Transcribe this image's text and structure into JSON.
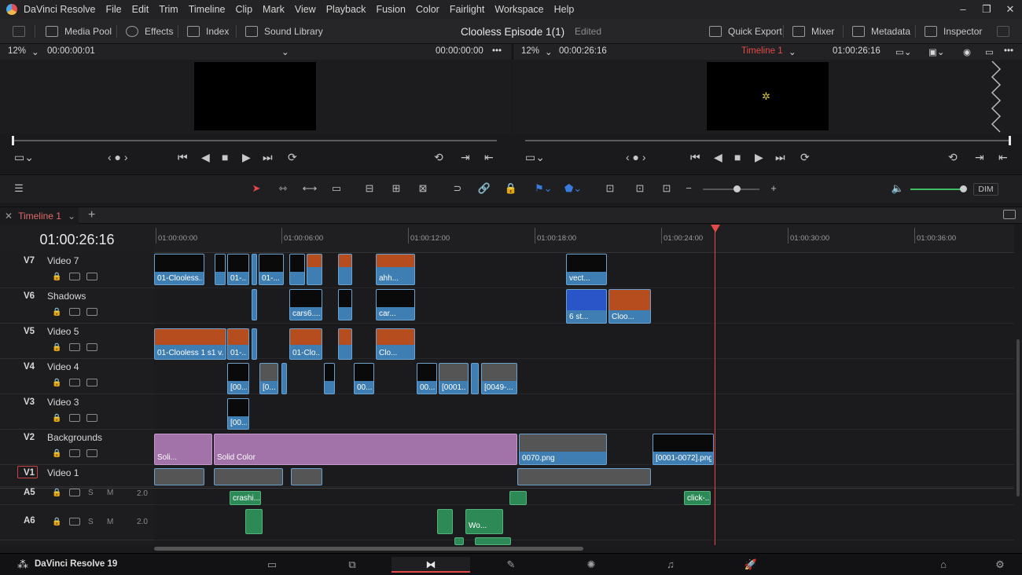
{
  "app": {
    "name": "DaVinci Resolve",
    "footer_name": "DaVinci Resolve 19"
  },
  "menu": [
    "File",
    "Edit",
    "Trim",
    "Timeline",
    "Clip",
    "Mark",
    "View",
    "Playback",
    "Fusion",
    "Color",
    "Fairlight",
    "Workspace",
    "Help"
  ],
  "toolbar": {
    "media_pool": "Media Pool",
    "effects": "Effects",
    "index": "Index",
    "sound_library": "Sound Library",
    "project_title": "Clooless Episode 1(1)",
    "project_status": "Edited",
    "quick_export": "Quick Export",
    "mixer": "Mixer",
    "metadata": "Metadata",
    "inspector": "Inspector"
  },
  "source_viewer": {
    "zoom": "12%",
    "timecode_left": "00:00:00:01",
    "timecode_right": "00:00:00:00"
  },
  "timeline_viewer": {
    "zoom": "12%",
    "timecode_left": "00:00:26:16",
    "timeline_name": "Timeline 1",
    "timecode_right": "01:00:26:16"
  },
  "audio": {
    "dim_label": "DIM"
  },
  "timeline": {
    "tab": "Timeline 1",
    "timecode": "01:00:26:16",
    "ruler": [
      "01:00:00:00",
      "01:00:06:00",
      "01:00:12:00",
      "01:00:18:00",
      "01:00:24:00",
      "01:00:30:00",
      "01:00:36:00"
    ],
    "tracks": [
      {
        "id": "V7",
        "name": "Video 7"
      },
      {
        "id": "V6",
        "name": "Shadows"
      },
      {
        "id": "V5",
        "name": "Video 5"
      },
      {
        "id": "V4",
        "name": "Video 4"
      },
      {
        "id": "V3",
        "name": "Video 3"
      },
      {
        "id": "V2",
        "name": "Backgrounds"
      },
      {
        "id": "V1",
        "name": "Video 1"
      },
      {
        "id": "A5",
        "name": "",
        "level": "2.0"
      },
      {
        "id": "A6",
        "name": "",
        "level": "2.0"
      }
    ],
    "clips": {
      "v7": [
        "01-Clooless...",
        "01-...",
        "01-...",
        "ahh...",
        "vect..."
      ],
      "v6": [
        "cars6....",
        "car...",
        "6 st...",
        "Cloo..."
      ],
      "v5": [
        "01-Clooless 1 s1 v...",
        "01-...",
        "01-Clo...",
        "Clo..."
      ],
      "v4": [
        "[00...",
        "[0...",
        "00...",
        "00...",
        "[0001...",
        "[0049-..."
      ],
      "v3": [
        "[00..."
      ],
      "v2": [
        "Soli...",
        "Solid Color",
        "0070.png",
        "[0001-0072].png"
      ],
      "a5": [
        "crashi...",
        "click-..."
      ],
      "a6": [
        "Wo..."
      ]
    }
  },
  "pages": [
    "media",
    "cut",
    "edit",
    "fusion",
    "color",
    "fairlight",
    "deliver"
  ],
  "colors": {
    "accent_red": "#e34a4a",
    "video_clip": "#3f7eb3",
    "solid_clip": "#a173a8",
    "audio_clip": "#2d8a57"
  }
}
